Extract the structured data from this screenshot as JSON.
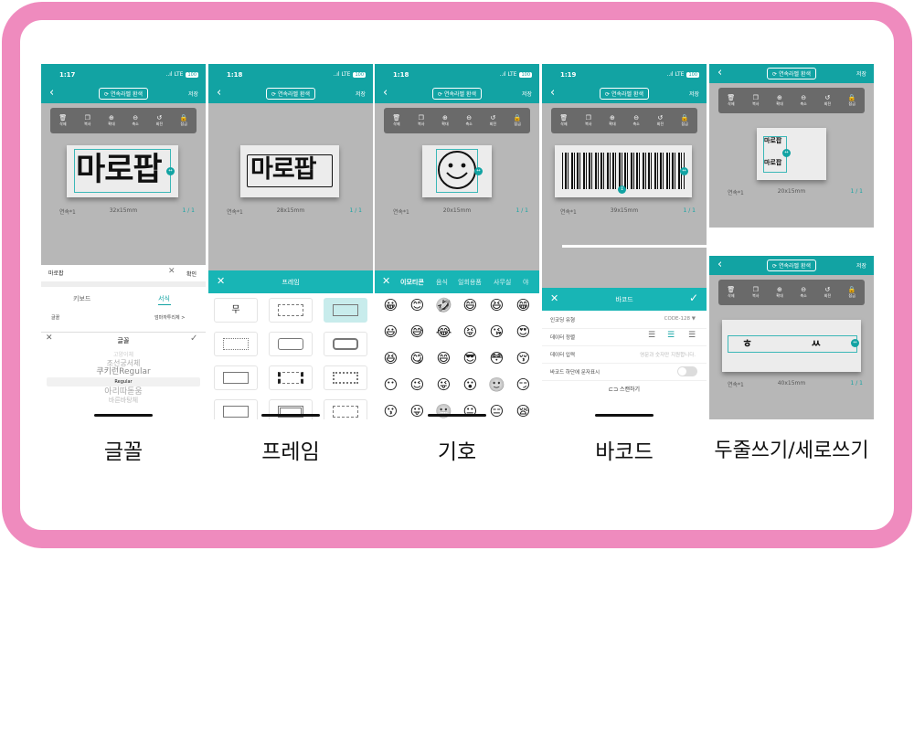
{
  "statusbar": {
    "times": [
      "1:17",
      "1:18",
      "1:18",
      "1:19"
    ],
    "network": "LTE",
    "battery": "100"
  },
  "navbar": {
    "switch_label": "연속라벨 환색",
    "save_label": "저장"
  },
  "toolbar": [
    {
      "label": "삭제",
      "icon": "trash-icon",
      "glyph": "🗑"
    },
    {
      "label": "복사",
      "icon": "copy-icon",
      "glyph": "❐"
    },
    {
      "label": "확대",
      "icon": "zoom-in-icon",
      "glyph": "⊕"
    },
    {
      "label": "축소",
      "icon": "zoom-out-icon",
      "glyph": "⊖"
    },
    {
      "label": "회전",
      "icon": "rotate-icon",
      "glyph": "↺"
    },
    {
      "label": "잠금",
      "icon": "lock-icon",
      "glyph": "🔒"
    }
  ],
  "screens": {
    "font": {
      "label_text": "마로팝",
      "copies": "연속*1",
      "size": "32x15mm",
      "page": "1 / 1",
      "input_value": "마로팝",
      "confirm": "확인",
      "tabs": [
        "키보드",
        "서식"
      ],
      "font_row_label": "글꼴",
      "font_row_value": "엄마까투리체 >",
      "sheet_title": "글꼴",
      "picker": [
        "고양이체",
        "조선궁서체",
        "쿠키런Regular",
        "Regular",
        "아리따돋움",
        "바른바탕체"
      ]
    },
    "frame": {
      "label_text": "마로팝",
      "copies": "연속*1",
      "size": "28x15mm",
      "page": "1 / 1",
      "sheet_title": "프레임",
      "first_cell": "무"
    },
    "symbol": {
      "copies": "연속*1",
      "size": "20x15mm",
      "page": "1 / 1",
      "tabs": [
        "이모티콘",
        "음식",
        "일회용품",
        "사무실",
        "야"
      ],
      "emoji": [
        "😀",
        "😊",
        "🤣",
        "😄",
        "😆",
        "😁",
        "😃",
        "😅",
        "😂",
        "😝",
        "😘",
        "😍",
        "😆",
        "😋",
        "😄",
        "😎",
        "😳",
        "😚",
        "😶",
        "😉",
        "😜",
        "😮",
        "🙂",
        "😏",
        "😗",
        "😛",
        "😬",
        "😐",
        "😑",
        "😪"
      ]
    },
    "barcode": {
      "copies": "연속*1",
      "size": "39x15mm",
      "page": "1 / 1",
      "sheet_title": "바코드",
      "rows": [
        {
          "key": "인코딩 유형",
          "value": "CODE-128 ▼"
        },
        {
          "key": "데이터 정렬",
          "value": ""
        },
        {
          "key": "데이터 입력",
          "value": "영문과 숫자만 지원합니다."
        },
        {
          "key": "바코드 하단에 문자표시",
          "value": ""
        }
      ],
      "scan_label": "스캔하기"
    },
    "vertical": {
      "label_line1": "마로팝",
      "label_line2": "마로팝",
      "copies": "연속*1",
      "size": "20x15mm",
      "page": "1 / 1"
    },
    "horizontal": {
      "label_text": "ㅎ ㅆ ㅍ",
      "copies": "연속*1",
      "size": "40x15mm",
      "page": "1 / 1"
    }
  },
  "captions": [
    "글꼴",
    "프레임",
    "기호",
    "바코드",
    "두줄쓰기/세로쓰기"
  ],
  "colors": {
    "accent": "#12a3a3",
    "frame": "#ef8bbe"
  }
}
